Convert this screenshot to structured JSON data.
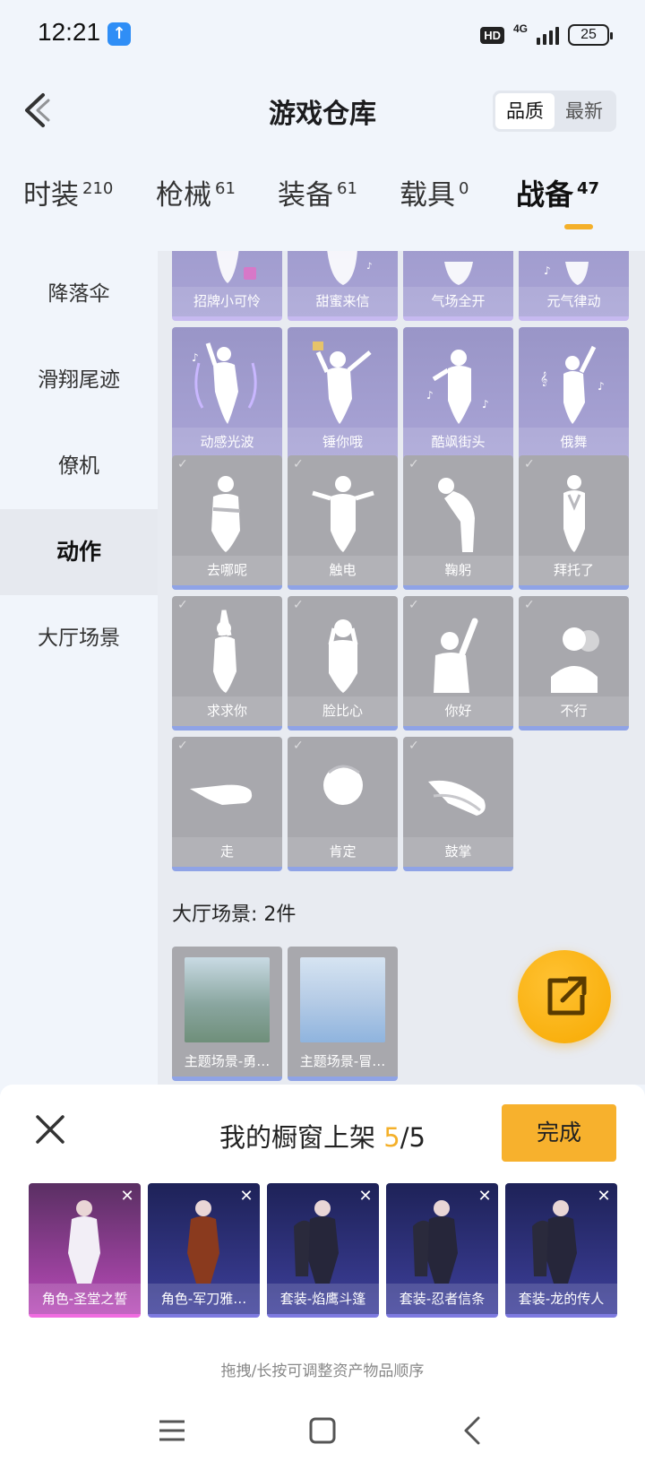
{
  "status": {
    "time": "12:21",
    "network": "4G",
    "hd": "HD",
    "battery": "25"
  },
  "header": {
    "title": "游戏仓库",
    "sort_options": [
      "品质",
      "最新"
    ],
    "active_sort": "品质"
  },
  "categories": [
    {
      "label": "时装",
      "count": "210"
    },
    {
      "label": "枪械",
      "count": "61"
    },
    {
      "label": "装备",
      "count": "61"
    },
    {
      "label": "载具",
      "count": "0"
    },
    {
      "label": "战备",
      "count": "47"
    }
  ],
  "active_category": "战备",
  "sidebar": {
    "items": [
      "降落伞",
      "滑翔尾迹",
      "僚机",
      "动作",
      "大厅场景"
    ],
    "active": "动作"
  },
  "actions_partial_row": [
    "招牌小可怜",
    "甜蜜来信",
    "气场全开",
    "元气律动"
  ],
  "actions_purple_row": [
    "动感光波",
    "锤你哦",
    "酷飒街头",
    "俄舞"
  ],
  "actions_gray": [
    "去哪呢",
    "触电",
    "鞠躬",
    "拜托了",
    "求求你",
    "脸比心",
    "你好",
    "不行",
    "走",
    "肯定",
    "鼓掌"
  ],
  "scene_section": {
    "title": "大厅场景: 2件",
    "items": [
      "主题场景-勇…",
      "主题场景-冒…"
    ]
  },
  "bottom_panel": {
    "title_prefix": "我的橱窗上架 ",
    "current": "5",
    "total": "/5",
    "done_label": "完成",
    "hint": "拖拽/长按可调整资产物品顺序",
    "shelf_items": [
      {
        "name": "角色-圣堂之誓",
        "style": "pink"
      },
      {
        "name": "角色-军刀雅…",
        "style": "blue"
      },
      {
        "name": "套装-焰鹰斗篷",
        "style": "blue"
      },
      {
        "name": "套装-忍者信条",
        "style": "blue"
      },
      {
        "name": "套装-龙的传人",
        "style": "blue"
      }
    ]
  },
  "colors": {
    "accent": "#f4b02a",
    "fab": "#f7a900",
    "purple_card": "#a29ed0",
    "gray_card": "#a8a8ad"
  }
}
